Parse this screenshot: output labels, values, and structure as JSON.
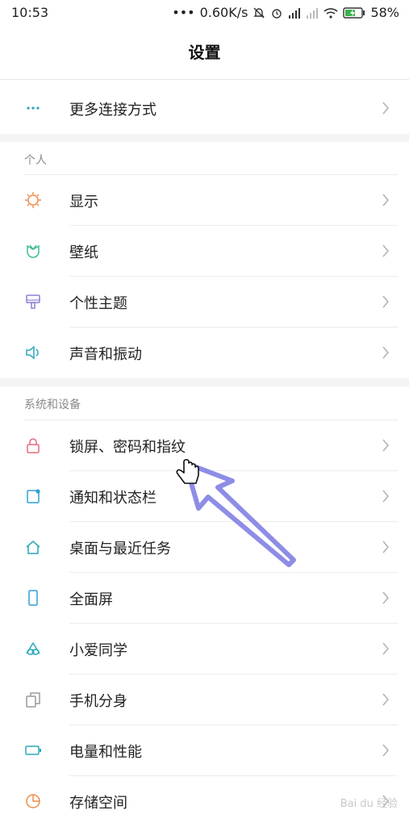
{
  "status_bar": {
    "time": "10:53",
    "network_speed": "0.60K/s",
    "battery_percent": "58%"
  },
  "header": {
    "title": "设置"
  },
  "top_item": {
    "label": "更多连接方式",
    "icon": "more-dots-icon"
  },
  "section_personal": {
    "title": "个人",
    "items": [
      {
        "label": "显示",
        "icon": "display-sun-icon",
        "color": "#f08a4b"
      },
      {
        "label": "壁纸",
        "icon": "wallpaper-tulip-icon",
        "color": "#3dbb9a"
      },
      {
        "label": "个性主题",
        "icon": "theme-brush-icon",
        "color": "#8f7fd6"
      },
      {
        "label": "声音和振动",
        "icon": "sound-speaker-icon",
        "color": "#2aa7b8"
      }
    ]
  },
  "section_system": {
    "title": "系统和设备",
    "items": [
      {
        "label": "锁屏、密码和指纹",
        "icon": "lock-icon",
        "color": "#e36b7a"
      },
      {
        "label": "通知和状态栏",
        "icon": "notification-icon",
        "color": "#2f9fd8"
      },
      {
        "label": "桌面与最近任务",
        "icon": "home-icon",
        "color": "#2aa7b8"
      },
      {
        "label": "全面屏",
        "icon": "fullscreen-phone-icon",
        "color": "#2f9fd8"
      },
      {
        "label": "小爱同学",
        "icon": "xiaoai-icon",
        "color": "#2aa7b8"
      },
      {
        "label": "手机分身",
        "icon": "dual-apps-icon",
        "color": "#9a9a9a"
      },
      {
        "label": "电量和性能",
        "icon": "battery-icon",
        "color": "#2aa7b8"
      },
      {
        "label": "存储空间",
        "icon": "storage-pie-icon",
        "color": "#f08a4b"
      }
    ]
  },
  "watermark": "Bai du 经验",
  "accent": {
    "pointer_arrow": "#8d8de6"
  }
}
